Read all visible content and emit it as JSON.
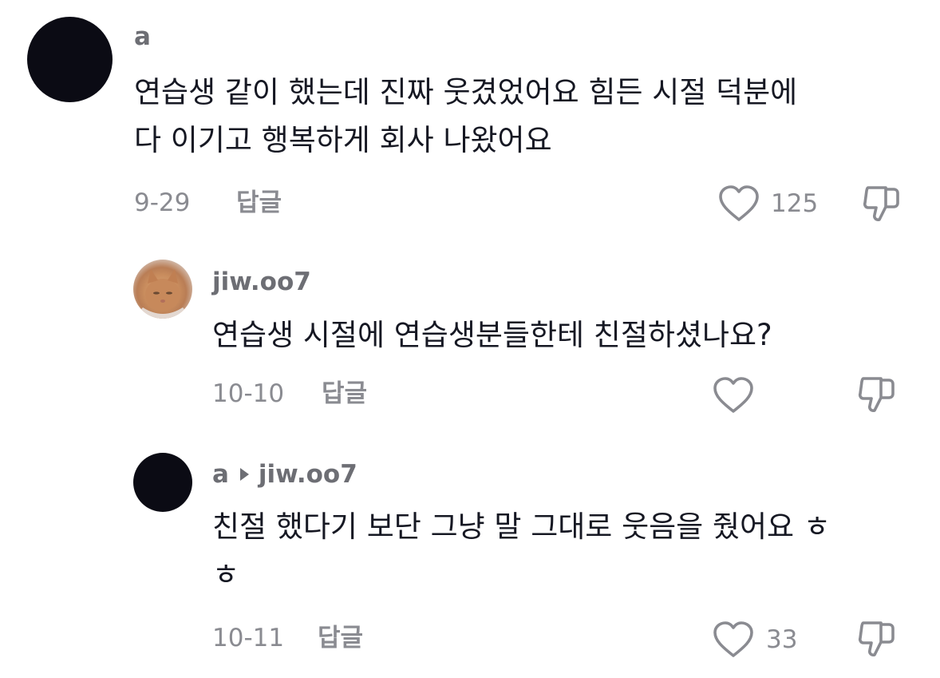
{
  "comments": [
    {
      "username": "a",
      "text": "연습생 같이 했는데 진짜 웃겼었어요 힘든 시절 덕분에\n다 이기고 행복하게 회사 나왔어요",
      "date": "9-29",
      "reply_label": "답글",
      "likes": "125"
    },
    {
      "username": "jiw.oo7",
      "text": "연습생 시절에 연습생분들한테 친절하셨나요?",
      "date": "10-10",
      "reply_label": "답글",
      "likes": ""
    },
    {
      "username": "a",
      "reply_to": "jiw.oo7",
      "text": "친절 했다기 보단 그냥 말 그대로 웃음을 줬어요 ㅎ\nㅎ",
      "date": "10-11",
      "reply_label": "답글",
      "likes": "33"
    }
  ],
  "icons": {
    "like": "heart-outline-icon",
    "dislike": "thumbs-down-outline-icon"
  },
  "colors": {
    "text": "#161823",
    "secondary": "#8a8b91",
    "username": "#6d6e74"
  }
}
